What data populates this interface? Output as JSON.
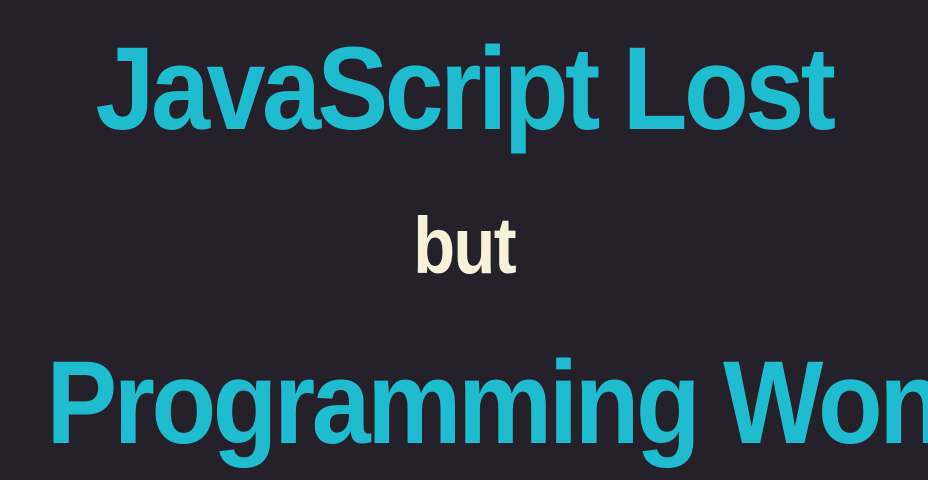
{
  "slide": {
    "line1": "JavaScript Lost",
    "line2": "but",
    "line3": "Programming Won"
  },
  "colors": {
    "background": "#25212b",
    "accent": "#1fbcd0",
    "secondary": "#f8f1da"
  }
}
